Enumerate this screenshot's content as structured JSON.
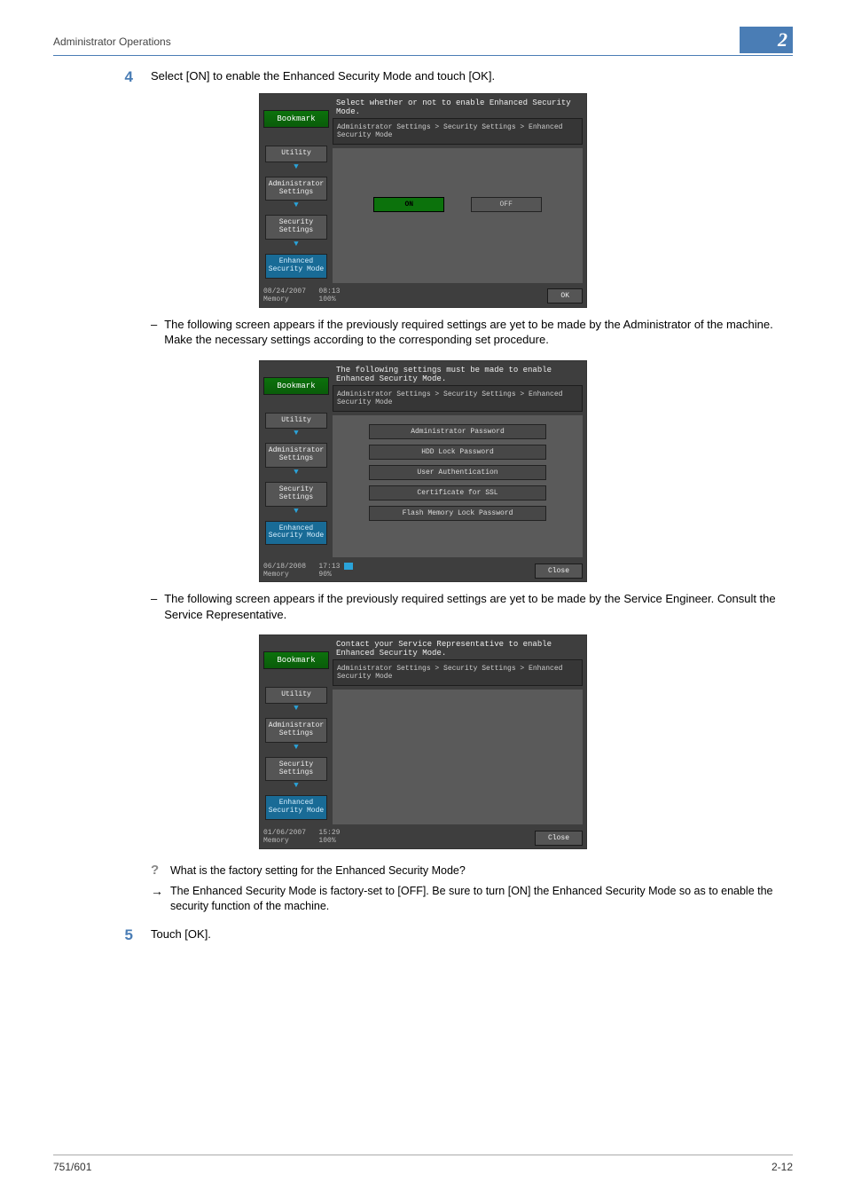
{
  "header": {
    "title": "Administrator Operations",
    "badge": "2"
  },
  "step4": {
    "number": "4",
    "text": "Select [ON] to enable the Enhanced Security Mode and touch [OK].",
    "note1": "The following screen appears if the previously required settings are yet to be made by the Administrator of the machine. Make the necessary settings according to the corresponding set procedure.",
    "note2": "The following screen appears if the previously required settings are yet to be made by the Service Engineer. Consult the Service Representative."
  },
  "panel1": {
    "topline": "Select whether or not to enable Enhanced Security Mode.",
    "bookmark": "Bookmark",
    "side": [
      "Utility",
      "Administrator\nSettings",
      "Security\nSettings",
      "Enhanced\nSecurity Mode"
    ],
    "breadcrumb": "Administrator Settings > Security Settings > Enhanced Security Mode",
    "on": "ON",
    "off": "OFF",
    "date": "08/24/2007",
    "time": "08:13",
    "memlabel": "Memory",
    "mempct": "100%",
    "ok": "OK"
  },
  "panel2": {
    "topline": "The following settings must be made to enable Enhanced Security Mode.",
    "bookmark": "Bookmark",
    "side": [
      "Utility",
      "Administrator\nSettings",
      "Security\nSettings",
      "Enhanced\nSecurity Mode"
    ],
    "breadcrumb": "Administrator Settings > Security Settings > Enhanced Security Mode",
    "items": [
      "Administrator Password",
      "HDD Lock Password",
      "User Authentication",
      "Certificate for SSL",
      "Flash Memory Lock Password"
    ],
    "date": "06/18/2008",
    "time": "17:13",
    "memlabel": "Memory",
    "mempct": "90%",
    "close": "Close"
  },
  "panel3": {
    "topline": "Contact your Service Representative to enable Enhanced Security Mode.",
    "bookmark": "Bookmark",
    "side": [
      "Utility",
      "Administrator\nSettings",
      "Security\nSettings",
      "Enhanced\nSecurity Mode"
    ],
    "breadcrumb": "Administrator Settings > Security Settings > Enhanced Security Mode",
    "date": "01/06/2007",
    "time": "15:29",
    "memlabel": "Memory",
    "mempct": "100%",
    "close": "Close"
  },
  "qa": {
    "q": "What is the factory setting for the Enhanced Security Mode?",
    "a": "The Enhanced Security Mode is factory-set to [OFF]. Be sure to turn [ON] the Enhanced Security Mode so as to enable the security function of the machine."
  },
  "step5": {
    "number": "5",
    "text": "Touch [OK]."
  },
  "footer": {
    "left": "751/601",
    "right": "2-12"
  }
}
